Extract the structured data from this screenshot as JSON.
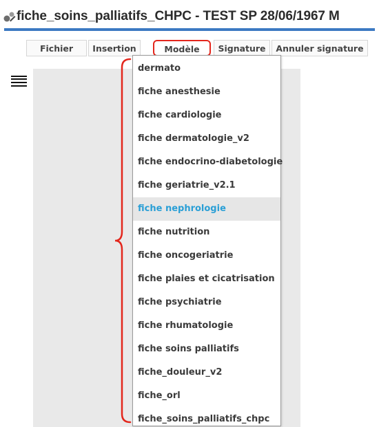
{
  "window": {
    "title": "fiche_soins_palliatifs_CHPC - TEST SP 28/06/1967 M",
    "accent_color": "#3c79c2"
  },
  "menubar": {
    "items": [
      {
        "label": "Fichier"
      },
      {
        "label": "Insertion"
      },
      {
        "label": "Modèle",
        "active": true
      },
      {
        "label": "Signature"
      },
      {
        "label": "Annuler signature"
      }
    ]
  },
  "annotation_color": "#e3261c",
  "dropdown": {
    "highlight_text_color": "#2a9fd6",
    "items": [
      {
        "label": "dermato"
      },
      {
        "label": "fiche anesthesie"
      },
      {
        "label": "fiche cardiologie"
      },
      {
        "label": "fiche dermatologie_v2"
      },
      {
        "label": "fiche endocrino-diabetologie"
      },
      {
        "label": "fiche geriatrie_v2.1"
      },
      {
        "label": "fiche nephrologie",
        "highlighted": true
      },
      {
        "label": "fiche nutrition"
      },
      {
        "label": "fiche oncogeriatrie"
      },
      {
        "label": "fiche plaies et cicatrisation"
      },
      {
        "label": "fiche psychiatrie"
      },
      {
        "label": "fiche rhumatologie"
      },
      {
        "label": "fiche soins palliatifs"
      },
      {
        "label": "fiche_douleur_v2"
      },
      {
        "label": "fiche_orl"
      },
      {
        "label": "fiche_soins_palliatifs_chpc"
      }
    ]
  },
  "icons": {
    "title_icon": "document-edit-icon",
    "menu_toggle": "hamburger-menu-icon"
  }
}
